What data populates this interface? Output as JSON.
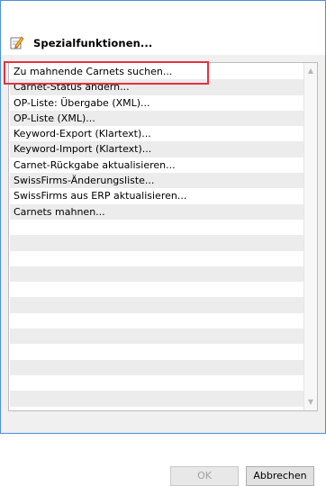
{
  "dialog": {
    "title": "Spezialfunktionen...",
    "icon": "edit-pencil-icon"
  },
  "list": {
    "items": [
      {
        "label": "Zu mahnende Carnets suchen..."
      },
      {
        "label": "Carnet-Status ändern..."
      },
      {
        "label": "OP-Liste: Übergabe (XML)..."
      },
      {
        "label": "OP-Liste (XML)..."
      },
      {
        "label": "Keyword-Export (Klartext)..."
      },
      {
        "label": "Keyword-Import (Klartext)..."
      },
      {
        "label": "Carnet-Rückgabe aktualisieren..."
      },
      {
        "label": "SwissFirms-Änderungsliste..."
      },
      {
        "label": "SwissFirms aus ERP aktualisieren..."
      },
      {
        "label": "Carnets mahnen..."
      }
    ],
    "highlighted_item": "Zu mahnende Carnets suchen...",
    "highlight_color": "#e8323c"
  },
  "buttons": {
    "ok_label": "OK",
    "ok_enabled": false,
    "cancel_label": "Abbrechen"
  },
  "colors": {
    "row_stripe": "#ececec",
    "dialog_background": "#f0f0f0",
    "window_border": "#4a90d9"
  }
}
